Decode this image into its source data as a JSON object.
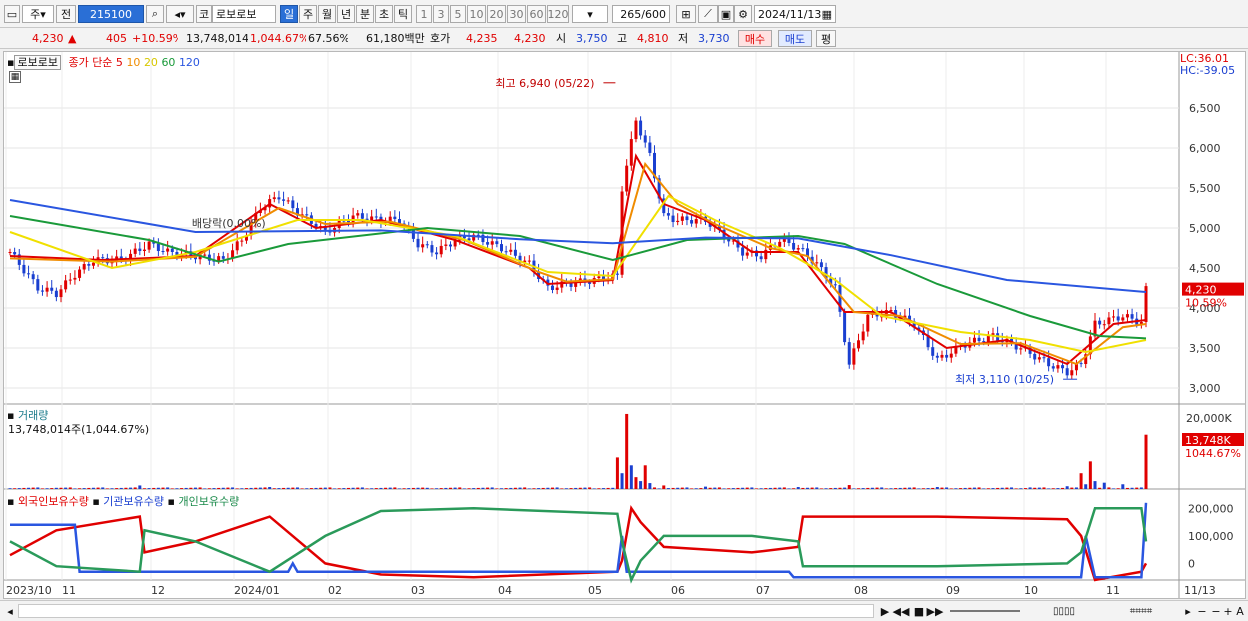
{
  "toolbar": {
    "period_week": "주",
    "prev_label": "전",
    "code": "215100",
    "market_badge": "코",
    "name": "로보로보",
    "periods": [
      "일",
      "주",
      "월",
      "년",
      "분",
      "초",
      "틱"
    ],
    "active_period": "일",
    "intervals": [
      "1",
      "3",
      "5",
      "10",
      "20",
      "30",
      "60",
      "120"
    ],
    "count": "265",
    "count_max": "/600",
    "date": "2024/11/13"
  },
  "quote": {
    "price": "4,230",
    "up_arrow": "▲",
    "change": "405",
    "change_pct": "+10.59%",
    "volume": "13,748,014",
    "volume_pct": "1,044.67%",
    "turnover_pct": "67.56%",
    "amount": "61,180백만",
    "bid_label": "호가",
    "bid1": "4,235",
    "bid2": "4,230",
    "open_label": "시",
    "open": "3,750",
    "high_label": "고",
    "high": "4,810",
    "low_label": "저",
    "low": "3,730",
    "buy_label": "매수",
    "sell_label": "매도",
    "eval_label": "평"
  },
  "colors": {
    "up": "#e00000",
    "down": "#1a3fd0",
    "ma5": "#e00000",
    "ma10": "#f08c00",
    "ma20": "#f0e000",
    "ma60": "#1a9a3a",
    "ma120": "#2a56e0",
    "foreign": "#e00000",
    "institution": "#2a56e0",
    "individual": "#2a9a5a"
  },
  "chart_data": [
    {
      "type": "candlestick",
      "title": "로보로보",
      "legend": [
        "종가 단순 5",
        "10",
        "20",
        "60",
        "120"
      ],
      "corner_labels": [
        "LC:36.01",
        "HC:-39.05"
      ],
      "y_ticks": [
        3000,
        3500,
        4000,
        4500,
        5000,
        5500,
        6000,
        6500
      ],
      "y_tick_labels": [
        "3,000",
        "3,500",
        "4,000",
        "4,500",
        "5,000",
        "5,500",
        "6,000",
        "6,500"
      ],
      "ylim": [
        2900,
        7100
      ],
      "x_labels": [
        "2023/10",
        "11",
        "12",
        "2024/01",
        "02",
        "03",
        "04",
        "05",
        "06",
        "07",
        "08",
        "09",
        "10",
        "11",
        "11/13"
      ],
      "close_series": [
        [
          0,
          4700
        ],
        [
          6,
          4250
        ],
        [
          10,
          4180
        ],
        [
          14,
          4420
        ],
        [
          18,
          4600
        ],
        [
          24,
          4600
        ],
        [
          30,
          4800
        ],
        [
          34,
          4700
        ],
        [
          40,
          4650
        ],
        [
          46,
          4600
        ],
        [
          50,
          4850
        ],
        [
          54,
          5250
        ],
        [
          58,
          5400
        ],
        [
          62,
          5200
        ],
        [
          68,
          4950
        ],
        [
          74,
          5150
        ],
        [
          80,
          5100
        ],
        [
          84,
          5100
        ],
        [
          88,
          4800
        ],
        [
          92,
          4700
        ],
        [
          96,
          4850
        ],
        [
          100,
          4900
        ],
        [
          106,
          4750
        ],
        [
          112,
          4550
        ],
        [
          116,
          4250
        ],
        [
          120,
          4300
        ],
        [
          126,
          4350
        ],
        [
          131,
          4400
        ],
        [
          132,
          5500
        ],
        [
          135,
          6350
        ],
        [
          138,
          5900
        ],
        [
          141,
          5150
        ],
        [
          144,
          5100
        ],
        [
          150,
          5100
        ],
        [
          154,
          4900
        ],
        [
          158,
          4700
        ],
        [
          162,
          4650
        ],
        [
          166,
          4850
        ],
        [
          170,
          4750
        ],
        [
          174,
          4550
        ],
        [
          178,
          4250
        ],
        [
          181,
          3300
        ],
        [
          185,
          3900
        ],
        [
          190,
          3950
        ],
        [
          195,
          3800
        ],
        [
          200,
          3350
        ],
        [
          206,
          3550
        ],
        [
          212,
          3650
        ],
        [
          218,
          3500
        ],
        [
          224,
          3300
        ],
        [
          228,
          3200
        ],
        [
          231,
          3300
        ],
        [
          234,
          3800
        ],
        [
          240,
          3900
        ],
        [
          244,
          3820
        ],
        [
          245,
          4230
        ]
      ],
      "ma_series": [
        {
          "name": "5",
          "points": [
            [
              0,
              4650
            ],
            [
              20,
              4600
            ],
            [
              40,
              4650
            ],
            [
              56,
              5300
            ],
            [
              66,
              5000
            ],
            [
              80,
              5100
            ],
            [
              96,
              4850
            ],
            [
              112,
              4500
            ],
            [
              116,
              4300
            ],
            [
              130,
              4350
            ],
            [
              135,
              5900
            ],
            [
              141,
              5300
            ],
            [
              150,
              5100
            ],
            [
              160,
              4700
            ],
            [
              170,
              4700
            ],
            [
              180,
              3950
            ],
            [
              190,
              3950
            ],
            [
              202,
              3500
            ],
            [
              215,
              3600
            ],
            [
              228,
              3300
            ],
            [
              238,
              3800
            ],
            [
              245,
              3850
            ]
          ]
        },
        {
          "name": "10",
          "points": [
            [
              0,
              4620
            ],
            [
              22,
              4580
            ],
            [
              40,
              4640
            ],
            [
              58,
              5250
            ],
            [
              68,
              5050
            ],
            [
              82,
              5080
            ],
            [
              98,
              4850
            ],
            [
              114,
              4450
            ],
            [
              120,
              4330
            ],
            [
              130,
              4360
            ],
            [
              137,
              5800
            ],
            [
              144,
              5300
            ],
            [
              152,
              5050
            ],
            [
              164,
              4750
            ],
            [
              172,
              4650
            ],
            [
              182,
              3950
            ],
            [
              192,
              3900
            ],
            [
              205,
              3550
            ],
            [
              218,
              3560
            ],
            [
              230,
              3300
            ],
            [
              240,
              3760
            ],
            [
              245,
              3800
            ]
          ]
        },
        {
          "name": "20",
          "points": [
            [
              0,
              4950
            ],
            [
              22,
              4500
            ],
            [
              40,
              4700
            ],
            [
              62,
              5100
            ],
            [
              76,
              5100
            ],
            [
              96,
              4900
            ],
            [
              116,
              4450
            ],
            [
              130,
              4400
            ],
            [
              142,
              5400
            ],
            [
              152,
              5100
            ],
            [
              166,
              4750
            ],
            [
              178,
              4350
            ],
            [
              188,
              3900
            ],
            [
              205,
              3700
            ],
            [
              220,
              3600
            ],
            [
              232,
              3450
            ],
            [
              245,
              3600
            ]
          ]
        },
        {
          "name": "60",
          "points": [
            [
              0,
              5150
            ],
            [
              30,
              4850
            ],
            [
              45,
              4580
            ],
            [
              60,
              4800
            ],
            [
              90,
              5000
            ],
            [
              110,
              4900
            ],
            [
              130,
              4600
            ],
            [
              146,
              4850
            ],
            [
              170,
              4900
            ],
            [
              180,
              4800
            ],
            [
              200,
              4300
            ],
            [
              220,
              3900
            ],
            [
              235,
              3650
            ],
            [
              245,
              3620
            ]
          ]
        },
        {
          "name": "120",
          "points": [
            [
              0,
              5350
            ],
            [
              40,
              4950
            ],
            [
              80,
              4970
            ],
            [
              110,
              4860
            ],
            [
              130,
              4810
            ],
            [
              150,
              4880
            ],
            [
              170,
              4870
            ],
            [
              190,
              4660
            ],
            [
              215,
              4350
            ],
            [
              245,
              4200
            ]
          ]
        }
      ],
      "annotations": [
        {
          "text": "최고 6,940 (05/22)",
          "x": 131,
          "y": 6940
        },
        {
          "text": "최저 3,110 (10/25)",
          "x": 231,
          "y": 3110
        },
        {
          "text": "배당락(0.00%)",
          "x": 50,
          "y": 4960
        }
      ],
      "last_price_label": "4,230",
      "last_pct_label": "10.59%"
    },
    {
      "type": "bar",
      "title": "거래량",
      "subtitle": "13,748,014주(1,044.67%)",
      "y_tick_labels": [
        "20,000K"
      ],
      "ylim": [
        0,
        20000
      ],
      "last_label": "13,748K",
      "last_pct_label": "1044.67%",
      "values": [
        [
          0,
          200
        ],
        [
          10,
          300
        ],
        [
          28,
          900
        ],
        [
          56,
          500
        ],
        [
          90,
          300
        ],
        [
          130,
          300
        ],
        [
          131,
          8000
        ],
        [
          132,
          4000
        ],
        [
          133,
          19000
        ],
        [
          134,
          6000
        ],
        [
          135,
          3000
        ],
        [
          136,
          2000
        ],
        [
          137,
          6000
        ],
        [
          138,
          1500
        ],
        [
          141,
          900
        ],
        [
          150,
          600
        ],
        [
          170,
          500
        ],
        [
          181,
          1000
        ],
        [
          200,
          500
        ],
        [
          220,
          400
        ],
        [
          228,
          700
        ],
        [
          231,
          4000
        ],
        [
          232,
          1200
        ],
        [
          233,
          7000
        ],
        [
          234,
          2000
        ],
        [
          236,
          1600
        ],
        [
          240,
          1200
        ],
        [
          245,
          13748
        ]
      ]
    },
    {
      "type": "line",
      "title": "외국인보유수량 · 기관보유수량 · 개인보유수량",
      "series": [
        {
          "name": "외국인보유수량",
          "points": [
            [
              0,
              30000
            ],
            [
              10,
              120000
            ],
            [
              28,
              170000
            ],
            [
              29,
              40000
            ],
            [
              40,
              80000
            ],
            [
              56,
              170000
            ],
            [
              68,
              0
            ],
            [
              80,
              -40000
            ],
            [
              100,
              -50000
            ],
            [
              131,
              -30000
            ],
            [
              132,
              10000
            ],
            [
              134,
              200000
            ],
            [
              136,
              150000
            ],
            [
              141,
              60000
            ],
            [
              160,
              40000
            ],
            [
              170,
              60000
            ],
            [
              171,
              170000
            ],
            [
              200,
              170000
            ],
            [
              228,
              160000
            ],
            [
              231,
              100000
            ],
            [
              234,
              -60000
            ],
            [
              244,
              -30000
            ],
            [
              245,
              0
            ]
          ]
        },
        {
          "name": "기관보유수량",
          "points": [
            [
              0,
              140000
            ],
            [
              14,
              140000
            ],
            [
              15,
              -30000
            ],
            [
              60,
              -30000
            ],
            [
              61,
              0
            ],
            [
              62,
              -30000
            ],
            [
              131,
              -30000
            ],
            [
              132,
              100000
            ],
            [
              133,
              -30000
            ],
            [
              168,
              -30000
            ],
            [
              169,
              -50000
            ],
            [
              231,
              -50000
            ],
            [
              232,
              100000
            ],
            [
              234,
              -50000
            ],
            [
              244,
              -50000
            ],
            [
              245,
              220000
            ]
          ]
        },
        {
          "name": "개인보유수량",
          "points": [
            [
              0,
              80000
            ],
            [
              10,
              -10000
            ],
            [
              28,
              -30000
            ],
            [
              29,
              120000
            ],
            [
              40,
              80000
            ],
            [
              56,
              -30000
            ],
            [
              68,
              100000
            ],
            [
              80,
              190000
            ],
            [
              100,
              200000
            ],
            [
              131,
              180000
            ],
            [
              132,
              80000
            ],
            [
              134,
              -60000
            ],
            [
              136,
              10000
            ],
            [
              141,
              100000
            ],
            [
              160,
              100000
            ],
            [
              170,
              80000
            ],
            [
              171,
              -10000
            ],
            [
              200,
              -10000
            ],
            [
              228,
              0
            ],
            [
              231,
              40000
            ],
            [
              234,
              200000
            ],
            [
              244,
              200000
            ],
            [
              245,
              80000
            ]
          ]
        }
      ],
      "y_tick_labels": [
        "200,000",
        "100,000",
        "0"
      ],
      "ylim": [
        -60000,
        230000
      ]
    }
  ],
  "legend": {
    "ma5": "종가 단순 5",
    "ma10": "10",
    "ma20": "20",
    "ma60": "60",
    "ma120": "120"
  }
}
